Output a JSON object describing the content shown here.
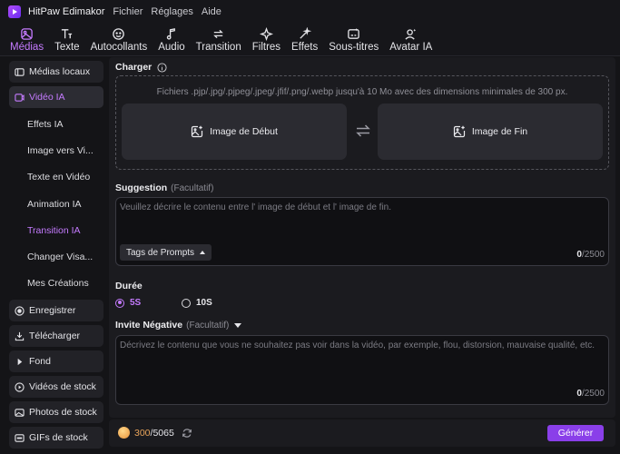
{
  "app": {
    "name": "HitPaw Edimakor"
  },
  "menu": [
    "Fichier",
    "Réglages",
    "Aide"
  ],
  "toolbar": [
    {
      "label": "Médias",
      "icon": "media-icon",
      "active": true
    },
    {
      "label": "Texte",
      "icon": "text-icon",
      "active": false
    },
    {
      "label": "Autocollants",
      "icon": "sticker-icon",
      "active": false
    },
    {
      "label": "Audio",
      "icon": "audio-icon",
      "active": false
    },
    {
      "label": "Transition",
      "icon": "transition-icon",
      "active": false
    },
    {
      "label": "Filtres",
      "icon": "filter-icon",
      "active": false
    },
    {
      "label": "Effets",
      "icon": "effects-icon",
      "active": false
    },
    {
      "label": "Sous-titres",
      "icon": "subtitles-icon",
      "active": false
    },
    {
      "label": "Avatar IA",
      "icon": "avatar-icon",
      "active": false
    }
  ],
  "sidebar": {
    "top": [
      {
        "label": "Médias locaux",
        "icon": "local-media-icon"
      },
      {
        "label": "Vidéo IA",
        "icon": "ai-video-icon",
        "active": true
      }
    ],
    "sub": [
      {
        "label": "Effets IA"
      },
      {
        "label": "Image vers Vi..."
      },
      {
        "label": "Texte en Vidéo"
      },
      {
        "label": "Animation IA"
      },
      {
        "label": "Transition IA",
        "active": true
      },
      {
        "label": "Changer Visa..."
      },
      {
        "label": "Mes Créations"
      }
    ],
    "bottom": [
      {
        "label": "Enregistrer",
        "icon": "record-icon"
      },
      {
        "label": "Télécharger",
        "icon": "download-icon"
      },
      {
        "label": "Fond",
        "icon": "background-icon"
      },
      {
        "label": "Vidéos de stock",
        "icon": "stock-video-icon"
      },
      {
        "label": "Photos de stock",
        "icon": "stock-photo-icon"
      },
      {
        "label": "GIFs de stock",
        "icon": "gif-icon"
      }
    ]
  },
  "upload": {
    "label": "Charger",
    "hint": "Fichiers .pjp/.jpg/.pjpeg/.jpeg/.jfif/.png/.webp jusqu'à 10 Mo avec des dimensions minimales de 300 px.",
    "start_label": "Image de Début",
    "end_label": "Image de Fin"
  },
  "suggestion": {
    "label": "Suggestion",
    "optional": "(Facultatif)",
    "placeholder": "Veuillez décrire le contenu entre l'  image de début et l'  image de fin.",
    "tags_label": "Tags de Prompts",
    "count": "0",
    "max": "/2500"
  },
  "duration": {
    "label": "Durée",
    "options": [
      {
        "label": "5S",
        "checked": true
      },
      {
        "label": "10S",
        "checked": false
      }
    ]
  },
  "negative": {
    "label": "Invite Négative",
    "optional": "(Facultatif)",
    "placeholder": "Décrivez le contenu que vous ne souhaitez pas voir dans la vidéo, par exemple, flou, distorsion, mauvaise qualité, etc.",
    "count": "0",
    "max": "/2500"
  },
  "footer": {
    "credits_used": "300",
    "credits_total": "/5065",
    "generate_label": "Générer"
  },
  "colors": {
    "accent": "#c57bff",
    "button": "#8a3fe9",
    "background": "#141417",
    "panel": "#1b1b1f"
  }
}
